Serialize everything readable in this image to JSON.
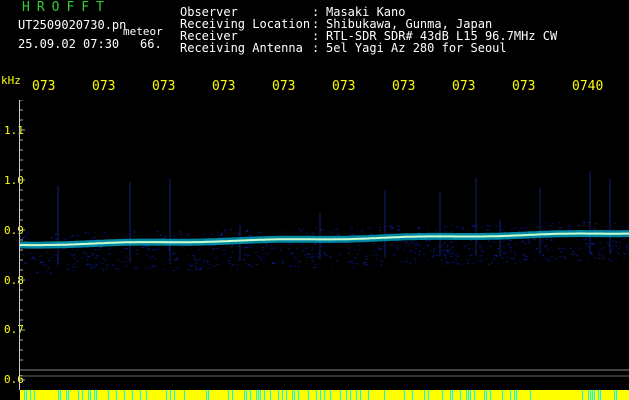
{
  "header": {
    "logo": "HROFFT",
    "filename": "UT2509020730.pn",
    "tag": "meteor",
    "datetime": "25.09.02 07:30",
    "count": "66."
  },
  "meta": [
    {
      "label": "Observer",
      "value": "Masaki Kano"
    },
    {
      "label": "Receiving Location",
      "value": "Shibukawa, Gunma, Japan"
    },
    {
      "label": "Receiver",
      "value": "RTL-SDR SDR# 43dB L15 96.7MHz CW"
    },
    {
      "label": "Receiving Antenna",
      "value": "5el Yagi Az 280 for Seoul"
    }
  ],
  "meta_separator": ":",
  "axis": {
    "unit": "kHz",
    "y_ticks": [
      "1.1",
      "1.0",
      "0.9",
      "0.8",
      "0.7",
      "0.6"
    ],
    "time_labels": [
      "073",
      "073",
      "073",
      "073",
      "073",
      "073",
      "073",
      "073",
      "073",
      "0740"
    ]
  },
  "colors": {
    "text_green": "#33cc33",
    "text_white": "#ffffff",
    "text_yellow": "#ffff00",
    "signal_core": "#ccffcc",
    "signal_edge": "#00aacc",
    "noise": "#0a1a99",
    "bar_yellow": "#ffff00",
    "bar_cyan": "#00ffff"
  }
}
